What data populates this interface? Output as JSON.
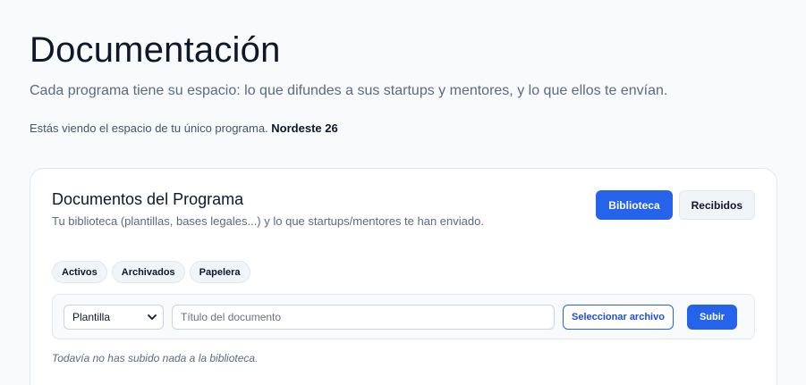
{
  "header": {
    "title": "Documentación",
    "subtitle": "Cada programa tiene su espacio: lo que difundes a sus startups y mentores, y lo que ellos te envían.",
    "context_prefix": "Estás viendo el espacio de tu único programa.",
    "program_name": "Nordeste 26"
  },
  "card": {
    "title": "Documentos del Programa",
    "subtitle": "Tu biblioteca (plantillas, bases legales...) y lo que startups/mentores te han enviado.",
    "view_tabs": {
      "library": "Biblioteca",
      "received": "Recibidos",
      "active": "Biblioteca"
    },
    "filters": [
      "Activos",
      "Archivados",
      "Papelera"
    ],
    "upload": {
      "type_selected": "Plantilla",
      "title_placeholder": "Título del documento",
      "title_value": "",
      "select_file_label": "Seleccionar archivo",
      "submit_label": "Subir"
    },
    "empty_message": "Todavía no has subido nada a la biblioteca."
  },
  "colors": {
    "accent": "#2563eb",
    "background": "#f8fafc",
    "card": "#ffffff",
    "border": "#e2e8f0"
  },
  "icons": {
    "select_chevron": "chevron-down-icon"
  }
}
